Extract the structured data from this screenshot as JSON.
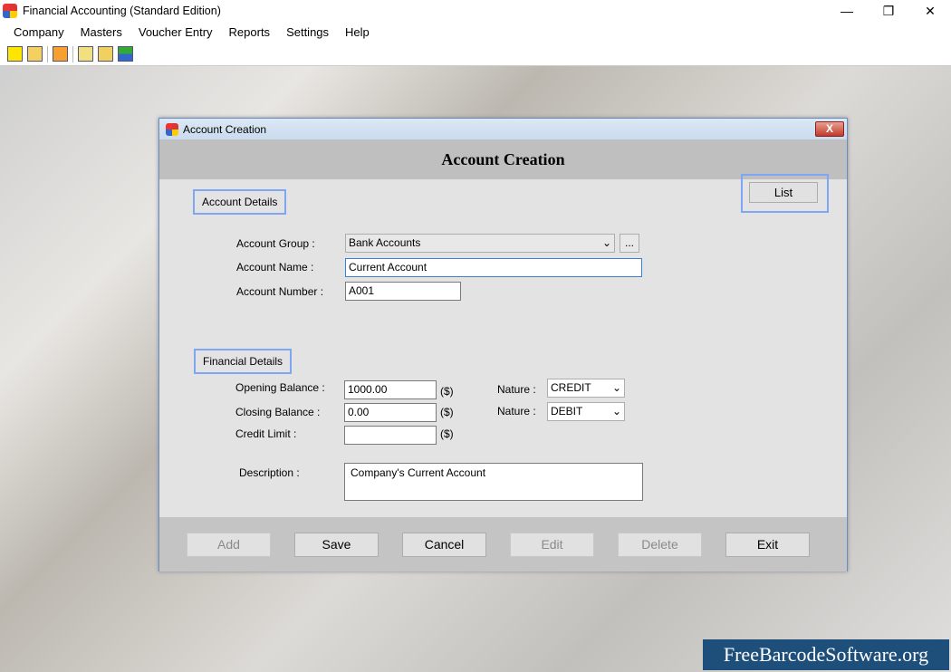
{
  "app": {
    "title": "Financial Accounting (Standard Edition)",
    "controls": [
      "—",
      "❐",
      "✕"
    ]
  },
  "menu": [
    "Company",
    "Masters",
    "Voucher Entry",
    "Reports",
    "Settings",
    "Help"
  ],
  "toolbar": [
    "new-icon",
    "open-icon",
    "table-icon",
    "balance-icon",
    "voucher-icon",
    "add-list-icon"
  ],
  "dialog": {
    "window_title": "Account Creation",
    "close_label": "X",
    "heading": "Account Creation",
    "list_label": "List",
    "account_details": {
      "label": "Account Details",
      "group_label": "Account Group :",
      "group_value": "Bank Accounts",
      "browse_label": "...",
      "name_label": "Account Name :",
      "name_value": "Current Account",
      "number_label": "Account Number :",
      "number_value": "A001"
    },
    "financial_details": {
      "label": "Financial Details",
      "opening_label": "Opening Balance :",
      "opening_value": "1000.00",
      "closing_label": "Closing Balance :",
      "closing_value": "0.00",
      "credit_label": "Credit Limit :",
      "credit_value": "",
      "currency": "($)",
      "nature_label": "Nature :",
      "nature1": "CREDIT",
      "nature2": "DEBIT",
      "description_label": "Description :",
      "description_value": "Company's Current Account"
    },
    "buttons": {
      "add": "Add",
      "save": "Save",
      "cancel": "Cancel",
      "edit": "Edit",
      "delete": "Delete",
      "exit": "Exit"
    }
  },
  "watermark": "FreeBarcodeSoftware.org"
}
